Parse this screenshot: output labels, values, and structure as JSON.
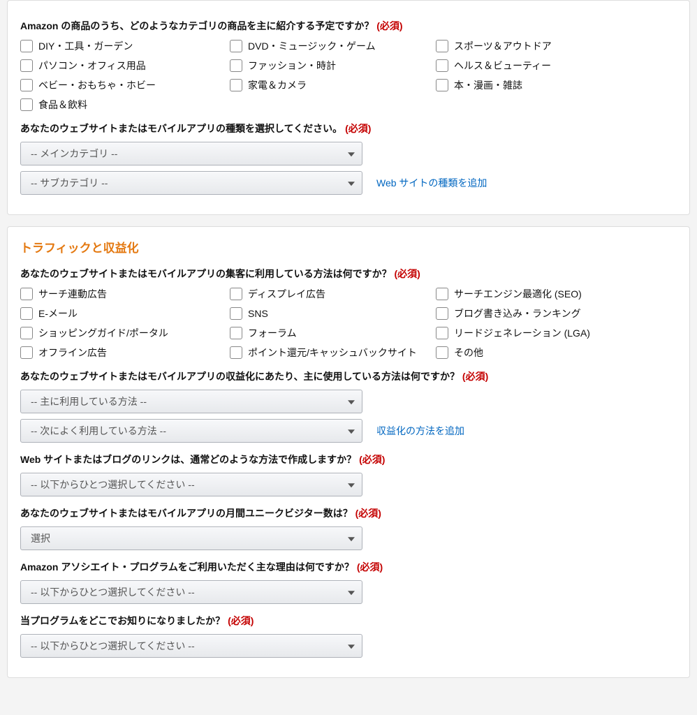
{
  "required_label": "(必須)",
  "panel1": {
    "q1": {
      "text": "Amazon の商品のうち、どのようなカテゴリの商品を主に紹介する予定ですか？",
      "options": [
        "DIY・工具・ガーデン",
        "DVD・ミュージック・ゲーム",
        "スポーツ＆アウトドア",
        "パソコン・オフィス用品",
        "ファッション・時計",
        "ヘルス＆ビューティー",
        "ベビー・おもちゃ・ホビー",
        "家電＆カメラ",
        "本・漫画・雑誌",
        "食品＆飲料"
      ]
    },
    "q2": {
      "text": "あなたのウェブサイトまたはモバイルアプリの種類を選択してください。",
      "select1": "-- メインカテゴリ --",
      "select2": "-- サブカテゴリ --",
      "add_link": "Web サイトの種類を追加"
    }
  },
  "panel2": {
    "title": "トラフィックと収益化",
    "q1": {
      "text": "あなたのウェブサイトまたはモバイルアプリの集客に利用している方法は何ですか？",
      "options": [
        "サーチ連動広告",
        "ディスプレイ広告",
        "サーチエンジン最適化 (SEO)",
        "E-メール",
        "SNS",
        "ブログ書き込み・ランキング",
        "ショッピングガイド/ポータル",
        "フォーラム",
        "リードジェネレーション (LGA)",
        "オフライン広告",
        "ポイント還元/キャッシュバックサイト",
        "その他"
      ]
    },
    "q2": {
      "text": "あなたのウェブサイトまたはモバイルアプリの収益化にあたり、主に使用している方法は何ですか？",
      "select1": "-- 主に利用している方法 --",
      "select2": "-- 次によく利用している方法 --",
      "add_link": "収益化の方法を追加"
    },
    "q3": {
      "text": "Web サイトまたはブログのリンクは、通常どのような方法で作成しますか？",
      "select": "-- 以下からひとつ選択してください --"
    },
    "q4": {
      "text": "あなたのウェブサイトまたはモバイルアプリの月間ユニークビジター数は？",
      "select": "選択"
    },
    "q5": {
      "text": "Amazon アソシエイト・プログラムをご利用いただく主な理由は何ですか？",
      "select": "-- 以下からひとつ選択してください --"
    },
    "q6": {
      "text": "当プログラムをどこでお知りになりましたか？",
      "select": "-- 以下からひとつ選択してください --"
    }
  }
}
